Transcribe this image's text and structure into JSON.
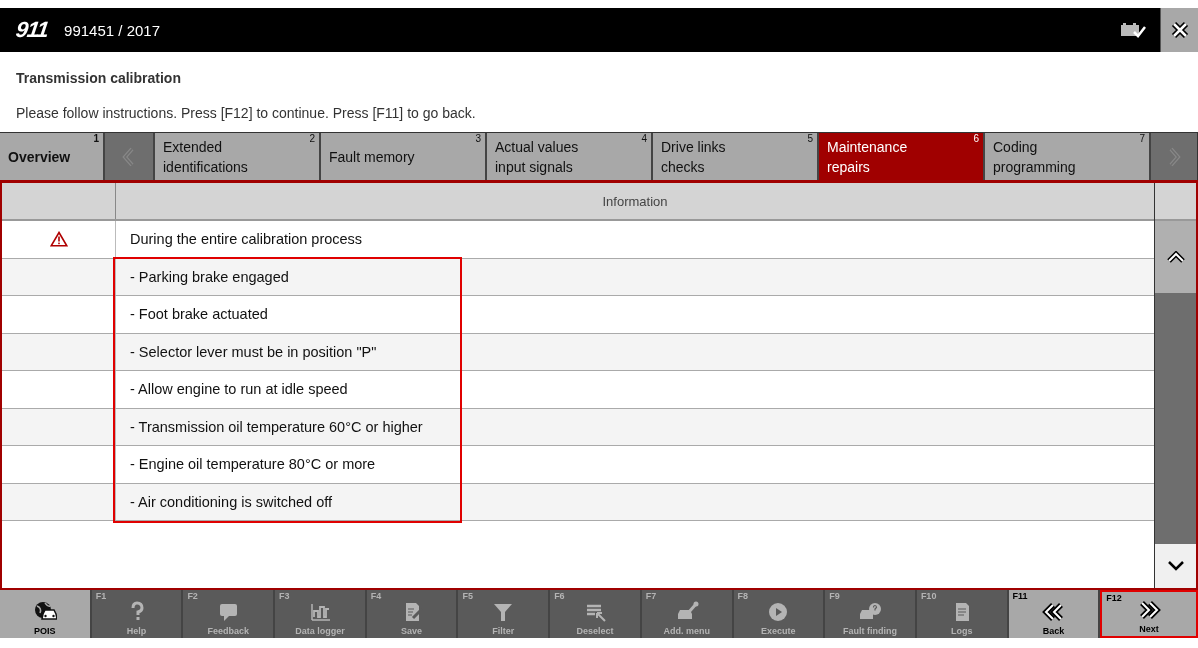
{
  "header": {
    "model": "911",
    "vehicle": "991451 / 2017"
  },
  "title": "Transmission calibration",
  "instruction": "Please follow instructions. Press [F12] to continue. Press [F11] to go back.",
  "tabs": [
    {
      "kind": "tab",
      "number": "1",
      "label": "Overview",
      "selected": false
    },
    {
      "kind": "prev"
    },
    {
      "kind": "tab",
      "number": "2",
      "label": "Extended identifications",
      "selected": false
    },
    {
      "kind": "tab",
      "number": "3",
      "label": "Fault memory",
      "selected": false
    },
    {
      "kind": "tab",
      "number": "4",
      "label": "Actual values input signals",
      "selected": false
    },
    {
      "kind": "tab",
      "number": "5",
      "label": "Drive links checks",
      "selected": false
    },
    {
      "kind": "tab",
      "number": "6",
      "label": "Maintenance repairs",
      "selected": true
    },
    {
      "kind": "tab",
      "number": "7",
      "label": "Coding programming",
      "selected": false
    },
    {
      "kind": "next"
    }
  ],
  "table": {
    "column_header": "Information",
    "rows": [
      {
        "warning": true,
        "text": "During the entire calibration process"
      }
    ],
    "marked_group": {
      "highlighted": true,
      "rows": [
        {
          "text": "- Parking brake engaged"
        },
        {
          "text": "- Foot brake actuated"
        },
        {
          "text": "- Selector lever must be in position \"P\""
        },
        {
          "text": "- Allow engine to run at idle speed"
        },
        {
          "text": "- Transmission oil temperature 60°C or higher"
        },
        {
          "text": "- Engine oil temperature 80°C or more"
        },
        {
          "text": "- Air conditioning is switched off"
        }
      ]
    }
  },
  "function_keys": [
    {
      "label": "POIS",
      "disabled": false,
      "highlighted": false
    },
    {
      "key": "F1",
      "label": "Help",
      "disabled": true,
      "highlighted": false
    },
    {
      "key": "F2",
      "label": "Feedback",
      "disabled": true,
      "highlighted": false
    },
    {
      "key": "F3",
      "label": "Data logger",
      "disabled": true,
      "highlighted": false
    },
    {
      "key": "F4",
      "label": "Save",
      "disabled": true,
      "highlighted": false
    },
    {
      "key": "F5",
      "label": "Filter",
      "disabled": true,
      "highlighted": false
    },
    {
      "key": "F6",
      "label": "Deselect",
      "disabled": true,
      "highlighted": false
    },
    {
      "key": "F7",
      "label": "Add. menu",
      "disabled": true,
      "highlighted": false
    },
    {
      "key": "F8",
      "label": "Execute",
      "disabled": true,
      "highlighted": false
    },
    {
      "key": "F9",
      "label": "Fault finding",
      "disabled": true,
      "highlighted": false
    },
    {
      "key": "F10",
      "label": "Logs",
      "disabled": true,
      "highlighted": false
    },
    {
      "key": "F11",
      "label": "Back",
      "disabled": false,
      "highlighted": false
    },
    {
      "key": "F12",
      "label": "Next",
      "disabled": false,
      "highlighted": true
    }
  ]
}
